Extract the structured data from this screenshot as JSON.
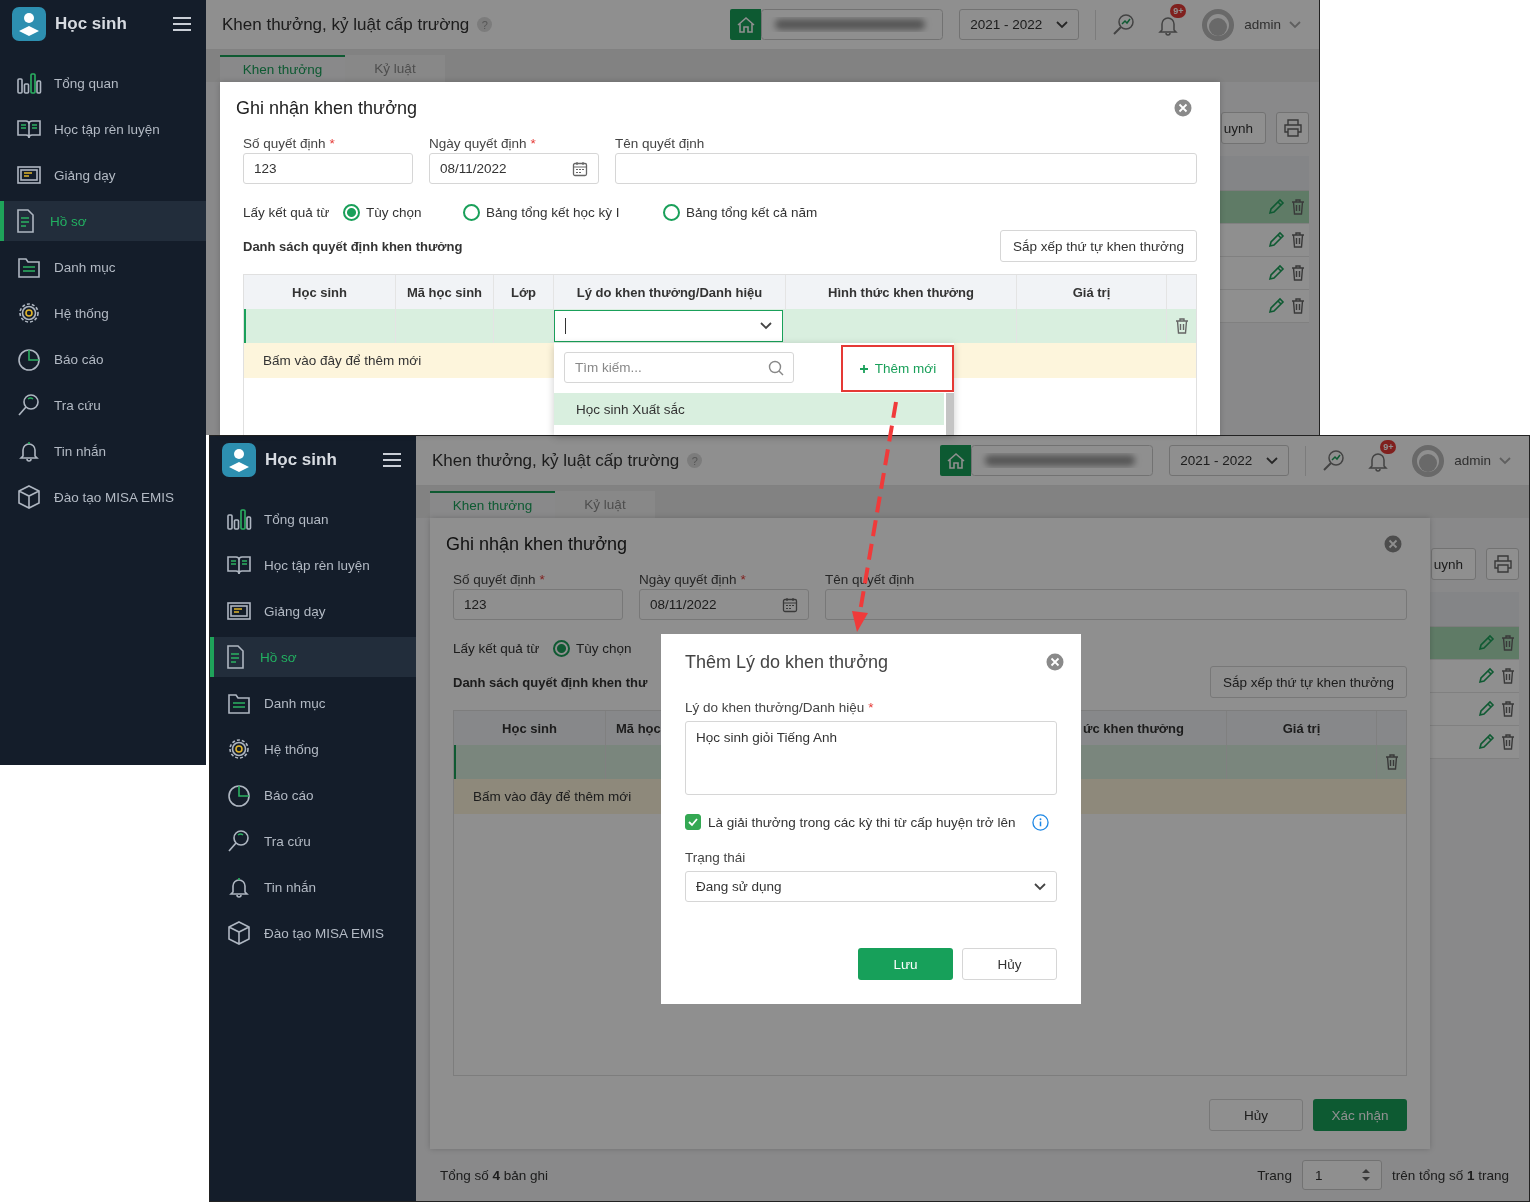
{
  "screens": [
    {
      "sidebar": {
        "app_title": "Học sinh",
        "items": [
          {
            "label": "Tổng quan",
            "selected": false
          },
          {
            "label": "Học tập rèn luyện",
            "selected": false
          },
          {
            "label": "Giảng dạy",
            "selected": false
          },
          {
            "label": "Hồ sơ",
            "selected": true
          },
          {
            "label": "Danh mục",
            "selected": false
          },
          {
            "label": "Hệ thống",
            "selected": false
          },
          {
            "label": "Báo cáo",
            "selected": false
          },
          {
            "label": "Tra cứu",
            "selected": false
          },
          {
            "label": "Tin nhắn",
            "selected": false
          },
          {
            "label": "Đào tạo MISA EMIS",
            "selected": false
          }
        ]
      },
      "header": {
        "title": "Khen thưởng, kỷ luật cấp trường",
        "help": "?",
        "year": "2021 - 2022",
        "badge": "9+",
        "user": "admin"
      },
      "tabs": [
        {
          "label": "Khen thưởng",
          "selected": true
        },
        {
          "label": "Kỷ luật",
          "selected": false
        }
      ],
      "background": {
        "button_text": "uynh",
        "rows": [
          {
            "selected": true
          },
          {
            "selected": false
          },
          {
            "selected": false
          },
          {
            "selected": false
          }
        ]
      },
      "dialog": {
        "title": "Ghi nhận khen thưởng",
        "fields": [
          {
            "label": "Số quyết định",
            "required_mark": "*",
            "kind": "text",
            "value": "123"
          },
          {
            "label": "Ngày quyết định",
            "required_mark": "*",
            "kind": "date",
            "value": "08/11/2022"
          },
          {
            "label": "Tên quyết định",
            "kind": "text"
          }
        ],
        "source_label": "Lấy kết quả từ",
        "source_options": [
          {
            "label": "Tùy chọn",
            "selected": true
          },
          {
            "label": "Bảng tổng kết học kỳ I",
            "selected": false
          },
          {
            "label": "Bảng tổng kết cả năm",
            "selected": false
          }
        ],
        "list_title": "Danh sách quyết định khen thưởng",
        "sort_button": "Sắp xếp thứ tự khen thưởng",
        "columns": [
          "Học sinh",
          "Mã học sinh",
          "Lớp",
          "Lý do khen thưởng/Danh hiệu",
          "Hình thức khen thưởng",
          "Giá trị"
        ],
        "add_row": "Bấm vào đây để thêm mới",
        "dropdown": {
          "search_placeholder": "Tìm kiếm...",
          "add_button": "Thêm mới",
          "items": [
            {
              "label": "Học sinh Xuất sắc",
              "selected": true
            }
          ]
        }
      }
    },
    {
      "sidebar": {
        "app_title": "Học sinh",
        "items": [
          {
            "label": "Tổng quan",
            "selected": false
          },
          {
            "label": "Học tập rèn luyện",
            "selected": false
          },
          {
            "label": "Giảng dạy",
            "selected": false
          },
          {
            "label": "Hồ sơ",
            "selected": true
          },
          {
            "label": "Danh mục",
            "selected": false
          },
          {
            "label": "Hệ thống",
            "selected": false
          },
          {
            "label": "Báo cáo",
            "selected": false
          },
          {
            "label": "Tra cứu",
            "selected": false
          },
          {
            "label": "Tin nhắn",
            "selected": false
          },
          {
            "label": "Đào tạo MISA EMIS",
            "selected": false
          }
        ]
      },
      "header": {
        "title": "Khen thưởng, kỷ luật cấp trường",
        "help": "?",
        "year": "2021 - 2022",
        "badge": "9+",
        "user": "admin"
      },
      "tabs": [
        {
          "label": "Khen thưởng",
          "selected": true
        },
        {
          "label": "Kỷ luật",
          "selected": false
        }
      ],
      "background": {
        "button_text": "uynh",
        "rows": [
          {
            "selected": true
          },
          {
            "selected": false
          },
          {
            "selected": false
          },
          {
            "selected": false
          }
        ]
      },
      "dialog": {
        "title": "Ghi nhận khen thưởng",
        "fields": [
          {
            "label": "Số quyết định",
            "required_mark": "*",
            "kind": "text",
            "value": "123"
          },
          {
            "label": "Ngày quyết định",
            "required_mark": "*",
            "kind": "date",
            "value": "08/11/2022"
          },
          {
            "label": "Tên quyết định",
            "kind": "text"
          }
        ],
        "source_label": "Lấy kết quả từ",
        "source_options": [
          {
            "label": "Tùy chọn",
            "selected": true
          }
        ],
        "list_title": "Danh sách quyết định khen thư",
        "sort_button": "Sắp xếp thứ tự khen thưởng",
        "columns": [
          "Học sinh",
          "Mã học",
          null,
          null,
          "ức khen thưởng",
          "Giá trị"
        ],
        "add_row": "Bấm vào đây để thêm mới",
        "buttons": [
          {
            "label": "Hủy",
            "kind": "secondary"
          },
          {
            "label": "Xác nhận",
            "kind": "primary"
          }
        ]
      },
      "page_footer": {
        "total": "Tổng số **4** bản ghi",
        "page_label": "Trang",
        "page": "1",
        "page_total": "trên tổng số **1** trang"
      },
      "overlay_dialog": {
        "title": "Thêm Lý do khen thưởng",
        "reason_label": "Lý do khen thưởng/Danh hiệu",
        "required_mark": "*",
        "reason_value": "Học sinh giỏi Tiếng Anh",
        "checkbox": {
          "label": "Là giải thưởng trong các kỳ thi từ cấp huyện trở lên",
          "checked": true
        },
        "status_label": "Trạng thái",
        "status_value": "Đang sử dụng",
        "buttons": [
          {
            "label": "Lưu",
            "kind": "primary"
          },
          {
            "label": "Hủy",
            "kind": "secondary"
          }
        ]
      }
    }
  ]
}
